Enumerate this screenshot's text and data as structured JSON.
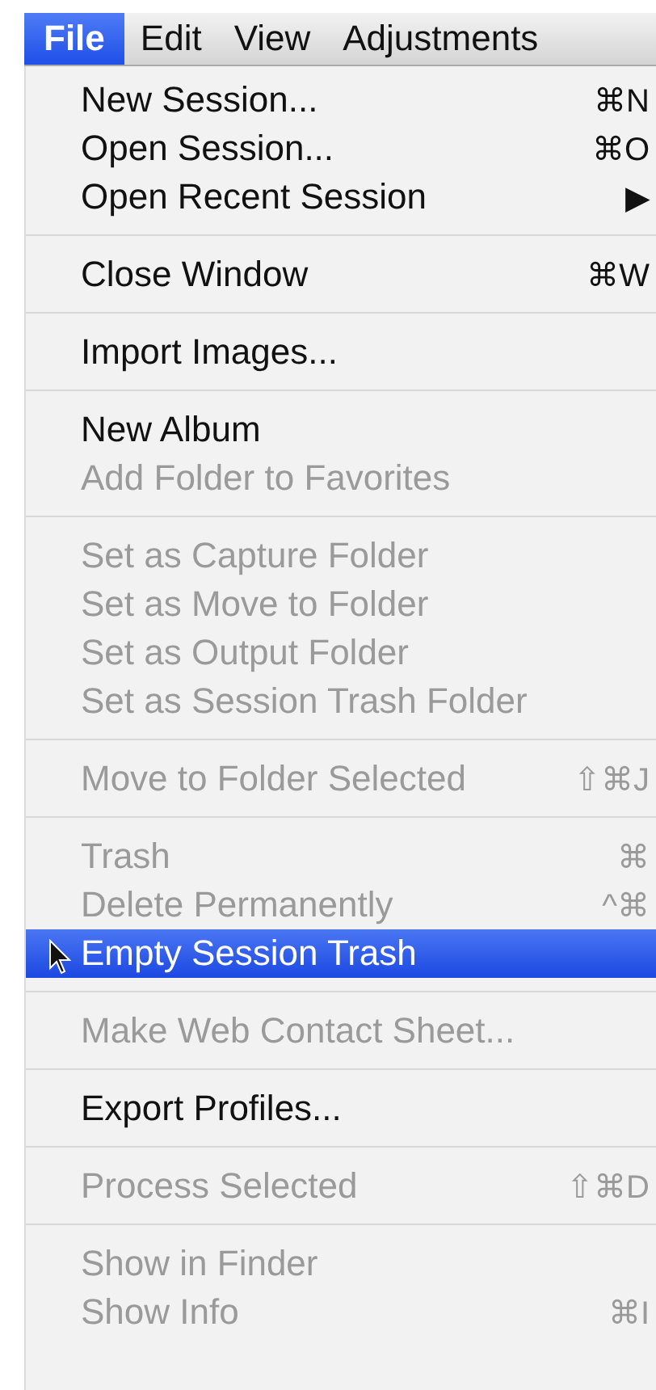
{
  "menu_bar": [
    {
      "label": "File",
      "selected": true
    },
    {
      "label": "Edit",
      "selected": false
    },
    {
      "label": "View",
      "selected": false
    },
    {
      "label": "Adjustments",
      "selected": false
    }
  ],
  "menu": {
    "groups": [
      {
        "items": [
          {
            "label": "New Session...",
            "shortcut": "⌘N",
            "disabled": false,
            "selected": false
          },
          {
            "label": "Open Session...",
            "shortcut": "⌘O",
            "disabled": false,
            "selected": false
          },
          {
            "label": "Open Recent Session",
            "shortcut": "▶",
            "disabled": false,
            "selected": false
          }
        ]
      },
      {
        "items": [
          {
            "label": "Close Window",
            "shortcut": "⌘W",
            "disabled": false,
            "selected": false
          }
        ]
      },
      {
        "items": [
          {
            "label": "Import Images...",
            "disabled": false,
            "selected": false
          }
        ]
      },
      {
        "items": [
          {
            "label": "New Album",
            "disabled": false,
            "selected": false
          },
          {
            "label": "Add Folder to Favorites",
            "disabled": true,
            "selected": false
          }
        ]
      },
      {
        "items": [
          {
            "label": "Set as Capture Folder",
            "disabled": true,
            "selected": false
          },
          {
            "label": "Set as Move to Folder",
            "disabled": true,
            "selected": false
          },
          {
            "label": "Set as Output Folder",
            "disabled": true,
            "selected": false
          },
          {
            "label": "Set as Session Trash Folder",
            "disabled": true,
            "selected": false
          }
        ]
      },
      {
        "items": [
          {
            "label": "Move to Folder Selected",
            "shortcut": "⇧⌘J",
            "disabled": true,
            "selected": false
          }
        ]
      },
      {
        "items": [
          {
            "label": "Trash",
            "shortcut": "⌘",
            "disabled": true,
            "selected": false
          },
          {
            "label": "Delete Permanently",
            "shortcut": "^⌘",
            "disabled": true,
            "selected": false
          },
          {
            "label": "Empty Session Trash",
            "disabled": false,
            "selected": true
          }
        ]
      },
      {
        "items": [
          {
            "label": "Make Web Contact Sheet...",
            "disabled": true,
            "selected": false
          }
        ]
      },
      {
        "items": [
          {
            "label": "Export Profiles...",
            "disabled": false,
            "selected": false
          }
        ]
      },
      {
        "items": [
          {
            "label": "Process Selected",
            "shortcut": "⇧⌘D",
            "disabled": true,
            "selected": false
          }
        ]
      },
      {
        "items": [
          {
            "label": "Show in Finder",
            "disabled": true,
            "selected": false
          },
          {
            "label": "Show Info",
            "shortcut": "⌘I",
            "disabled": true,
            "selected": false
          }
        ]
      }
    ]
  }
}
